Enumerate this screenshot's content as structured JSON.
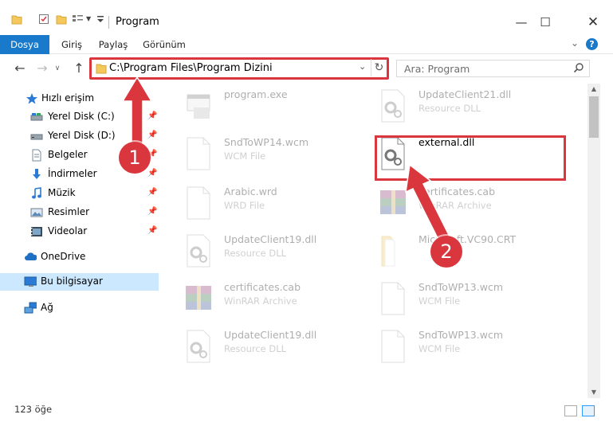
{
  "window": {
    "title": "Program",
    "controls": [
      "minimize",
      "maximize",
      "close"
    ]
  },
  "ribbon": {
    "tabs": [
      "Dosya",
      "Giriş",
      "Paylaş",
      "Görünüm"
    ],
    "help_label": "?"
  },
  "address": {
    "path": "C:\\Program Files\\Program Dizini",
    "search_placeholder": "Ara: Program"
  },
  "nav": {
    "quick_access": "Hızlı erişim",
    "items": [
      {
        "label": "Yerel Disk (C:)",
        "icon": "drive-icon",
        "pinned": true
      },
      {
        "label": "Yerel Disk (D:)",
        "icon": "drive-icon",
        "pinned": true
      },
      {
        "label": "Belgeler",
        "icon": "documents-icon",
        "pinned": true
      },
      {
        "label": "İndirmeler",
        "icon": "download-icon",
        "pinned": true
      },
      {
        "label": "Müzik",
        "icon": "music-icon",
        "pinned": true
      },
      {
        "label": "Resimler",
        "icon": "pictures-icon",
        "pinned": true
      },
      {
        "label": "Videolar",
        "icon": "videos-icon",
        "pinned": true
      }
    ],
    "onedrive": "OneDrive",
    "this_pc": "Bu bilgisayar",
    "network": "Ağ"
  },
  "files": [
    {
      "name": "program.exe",
      "type": "",
      "icon": "exe-icon",
      "faded": true
    },
    {
      "name": "UpdateClient21.dll",
      "type": "Resource DLL",
      "icon": "dll-icon",
      "faded": true
    },
    {
      "name": "SndToWP14.wcm",
      "type": "WCM File",
      "icon": "file-icon",
      "faded": true
    },
    {
      "name": "external.dll",
      "type": "",
      "icon": "dll-icon",
      "faded": false
    },
    {
      "name": "Arabic.wrd",
      "type": "WRD File",
      "icon": "file-icon",
      "faded": true
    },
    {
      "name": "certificates.cab",
      "type": "WinRAR Archive",
      "icon": "winrar-icon",
      "faded": true
    },
    {
      "name": "UpdateClient19.dll",
      "type": "Resource DLL",
      "icon": "dll-icon",
      "faded": true
    },
    {
      "name": "Microsoft.VC90.CRT",
      "type": "",
      "icon": "folder-icon",
      "faded": true
    },
    {
      "name": "certificates.cab",
      "type": "WinRAR Archive",
      "icon": "winrar-icon",
      "faded": true
    },
    {
      "name": "SndToWP13.wcm",
      "type": "WCM File",
      "icon": "file-icon",
      "faded": true
    },
    {
      "name": "UpdateClient19.dll",
      "type": "Resource DLL",
      "icon": "dll-icon",
      "faded": true
    },
    {
      "name": "SndToWP13.wcm",
      "type": "WCM File",
      "icon": "file-icon",
      "faded": true
    }
  ],
  "status": {
    "item_count": "123 öğe"
  },
  "callouts": [
    "1",
    "2"
  ],
  "colors": {
    "accent": "#1979ca",
    "highlight": "#d9363e",
    "selected": "#cce8ff"
  }
}
